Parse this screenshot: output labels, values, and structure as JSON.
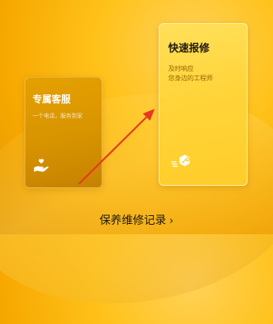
{
  "cards": [
    {
      "title": "专属客服",
      "subtitle": "一个电话，服务到家",
      "icon": "hand-heart-icon"
    },
    {
      "title": "快速报修",
      "subtitle_lines": [
        "及时响应",
        "您身边的工程师"
      ],
      "icon": "wrench-hexagon-icon"
    }
  ],
  "footer": {
    "records_label": "保养维修记录",
    "chevron": "›"
  },
  "colors": {
    "arrow": "#e8391f",
    "accent": "#ffcc2a"
  }
}
